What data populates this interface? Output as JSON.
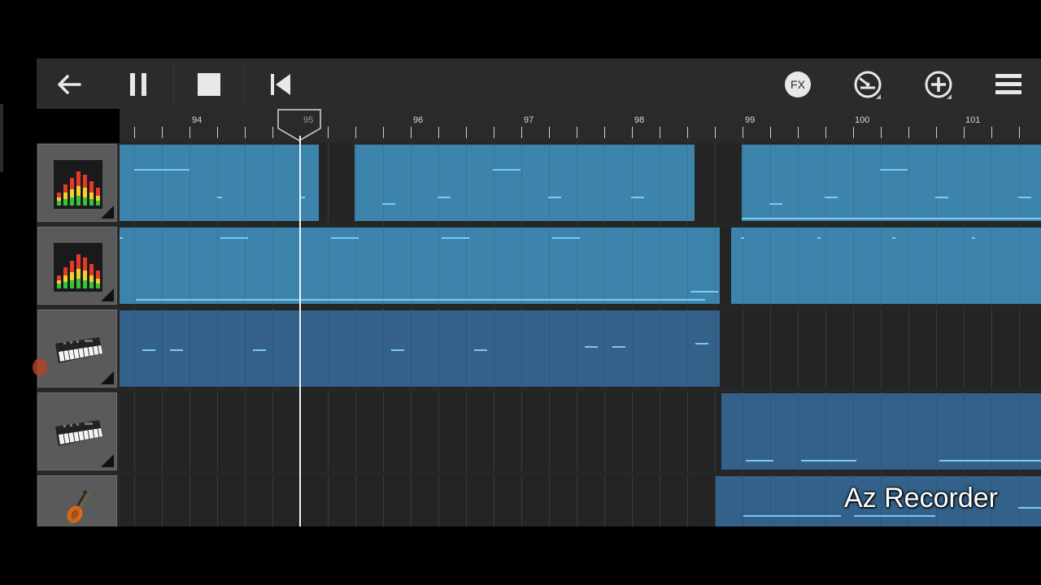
{
  "toolbar": {
    "back_icon": "arrow-left-icon",
    "pause_icon": "pause-icon",
    "stop_icon": "stop-icon",
    "rewind_icon": "skip-to-start-icon",
    "fx_label": "FX",
    "metronome_icon": "tempo-knob-icon",
    "add_icon": "add-track-icon",
    "menu_icon": "hamburger-menu-icon"
  },
  "ruler": {
    "labels": [
      "94",
      "95",
      "96",
      "97",
      "98",
      "99",
      "100",
      "101"
    ]
  },
  "tracks": [
    {
      "instrument": "drum-equalizer-icon"
    },
    {
      "instrument": "drum-equalizer-icon"
    },
    {
      "instrument": "keyboard-synth-icon"
    },
    {
      "instrument": "keyboard-synth-icon"
    },
    {
      "instrument": "violin-icon"
    }
  ],
  "watermark": "Az Recorder",
  "colors": {
    "clip": "#3f8ab5",
    "clip_dark": "#34658f",
    "note": "#7fd3ff",
    "background": "#272727"
  }
}
